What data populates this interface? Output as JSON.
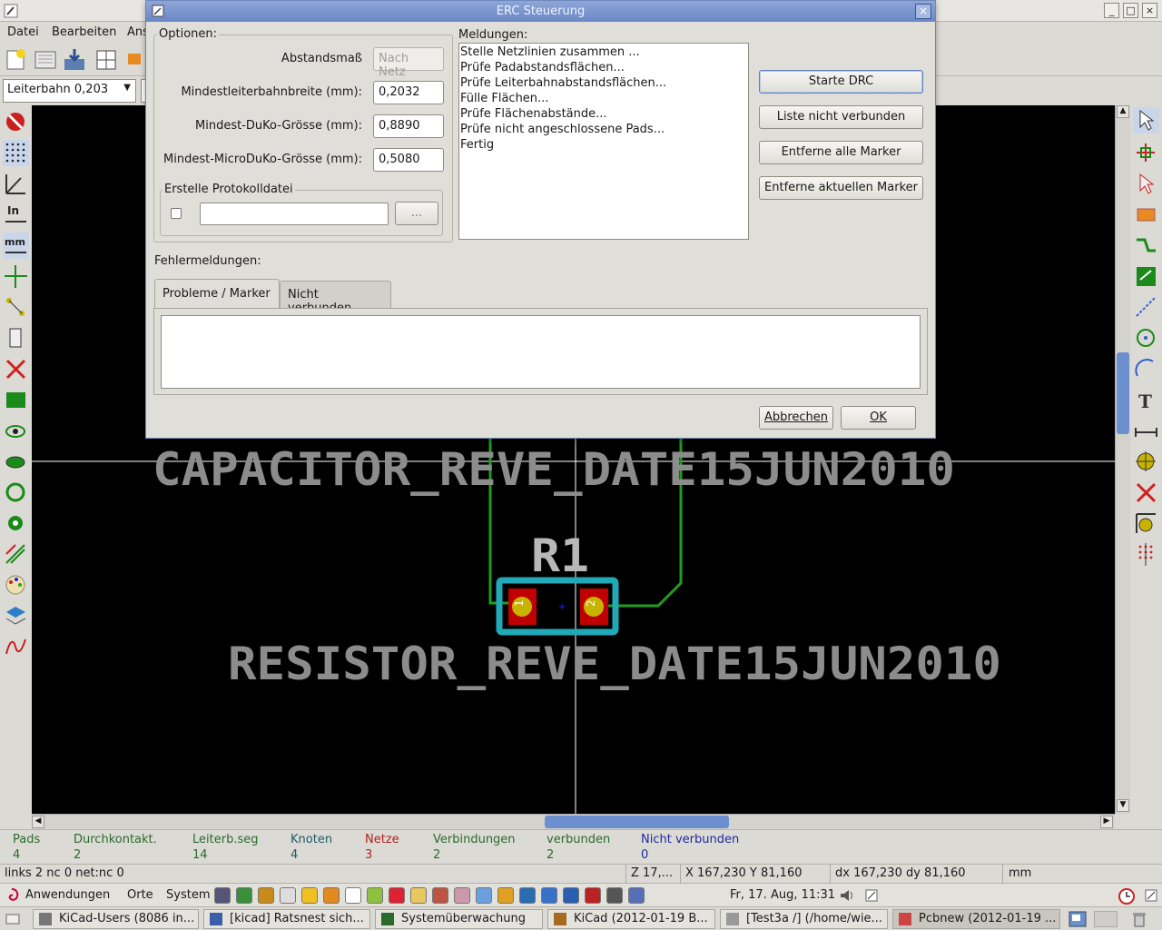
{
  "window": {
    "title_icon": "pencil-icon",
    "btn_min": "_",
    "btn_max": "□",
    "btn_close": "×"
  },
  "menu": {
    "datei": "Datei",
    "bearbeiten": "Bearbeiten",
    "ansicht": "Ans"
  },
  "toolbar2": {
    "track_width": "Leiterbahn 0,203",
    "chevron": "▼"
  },
  "canvas": {
    "text_capacitor": "CAPACITOR_REVE_DATE15JUN2010",
    "text_ref": "R1",
    "text_resistor": "RESISTOR_REVE_DATE15JUN2010",
    "pad1": "1",
    "pad2": "2"
  },
  "status_info": {
    "cols": [
      {
        "label": "Pads",
        "value": "4",
        "color": "#2b6b2b"
      },
      {
        "label": "Durchkontakt.",
        "value": "2",
        "color": "#2b6b2b"
      },
      {
        "label": "Leiterb.seg",
        "value": "14",
        "color": "#2b6b2b"
      },
      {
        "label": "Knoten",
        "value": "4",
        "color": "#1f5a66"
      },
      {
        "label": "Netze",
        "value": "3",
        "color": "#b02222"
      },
      {
        "label": "Verbindungen",
        "value": "2",
        "color": "#2b6b2b"
      },
      {
        "label": "verbunden",
        "value": "2",
        "color": "#2b6b2b"
      },
      {
        "label": "Nicht verbunden",
        "value": "0",
        "color": "#1f2aa0"
      }
    ]
  },
  "statusbar": {
    "links": "links 2 nc 0  net:nc 0",
    "zoom": "Z 17,...",
    "coords": "X 167,230  Y 81,160",
    "delta": "dx 167,230  dy 81,160",
    "units": "mm"
  },
  "panel": {
    "apps": "Anwendungen",
    "places": "Orte",
    "system": "System",
    "clock": "Fr, 17. Aug, 11:31"
  },
  "taskbar": {
    "tasks": [
      "KiCad-Users (8086 in...",
      "[kicad] Ratsnest sich...",
      "Systemüberwachung",
      "KiCad (2012-01-19 B...",
      "[Test3a /] (/home/wie...",
      "Pcbnew (2012-01-19 ..."
    ]
  },
  "dialog": {
    "title": "ERC Steuerung",
    "close": "×",
    "options_legend": "Optionen:",
    "label_clearance": "Abstandsmaß",
    "value_clearance": "Nach Netz",
    "label_min_track": "Mindestleiterbahnbreite (mm):",
    "value_min_track": "0,2032",
    "label_min_via": "Mindest-DuKo-Grösse (mm):",
    "value_min_via": "0,8890",
    "label_min_microvia": "Mindest-MicroDuKo-Grösse (mm):",
    "value_min_microvia": "0,5080",
    "log_legend": "Erstelle Protokolldatei",
    "log_path": "",
    "browse": "...",
    "messages_label": "Meldungen:",
    "messages": [
      "Stelle Netzlinien zusammen ...",
      "Prüfe Padabstandsflächen...",
      "Prüfe Leiterbahnabstandsflächen...",
      "Fülle Flächen...",
      "Prüfe Flächenabstände...",
      "Prüfe nicht angeschlossene Pads...",
      "Fertig"
    ],
    "btn_start": "Starte DRC",
    "btn_list": "Liste nicht verbunden",
    "btn_remove_all": "Entferne alle Marker",
    "btn_remove_current": "Entferne aktuellen Marker",
    "errors_label": "Fehlermeldungen:",
    "tab_problems": "Probleme / Marker",
    "tab_unconnected": "Nicht verbunden",
    "btn_cancel": "Abbrechen",
    "btn_ok": "OK"
  },
  "colors": {
    "pad": "#c00000",
    "pad_center": "#c8b400",
    "track": "#1e9e1e",
    "courtyard": "#22a9b8",
    "text": "#8c8c8c"
  }
}
